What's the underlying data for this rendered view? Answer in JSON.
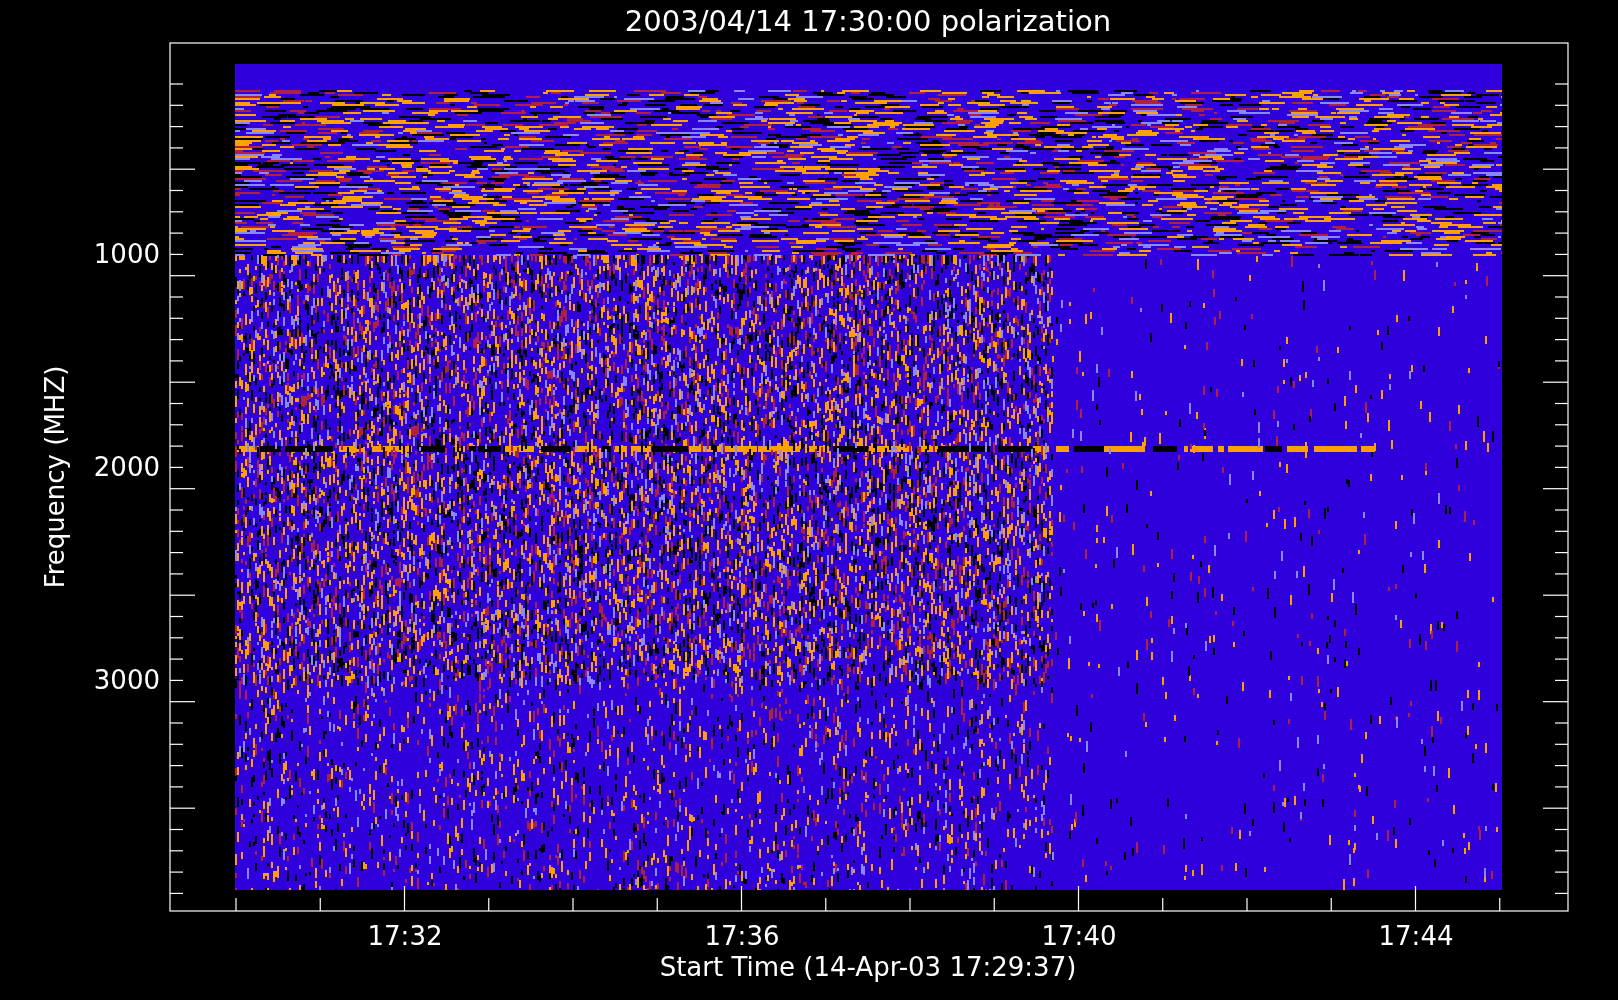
{
  "title": "2003/04/14 17:30:00 polarization",
  "plot": {
    "ylabel": "Frequency (MHZ)",
    "xlabel": "Start Time (14-Apr-03 17:29:37)",
    "yticks": [
      "1000",
      "2000",
      "3000"
    ],
    "xticks": [
      "17:32",
      "17:36",
      "17:40",
      "17:44"
    ]
  }
}
